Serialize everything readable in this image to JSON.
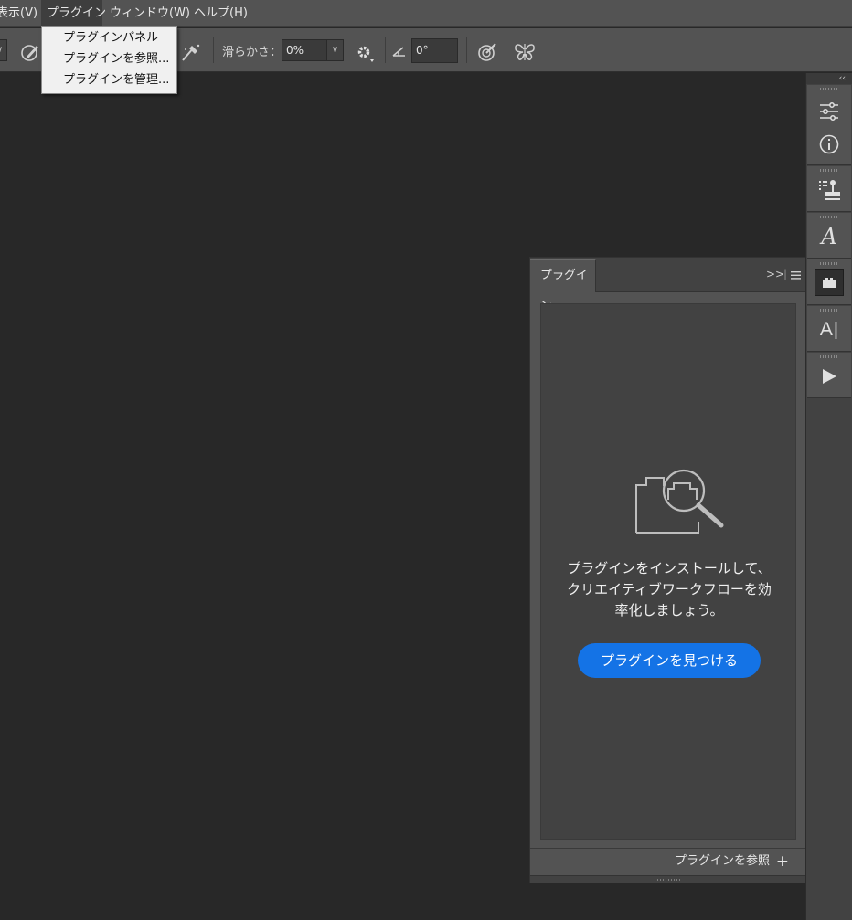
{
  "menubar": {
    "items": [
      {
        "label": "表示(V)"
      },
      {
        "label": "プラグイン"
      },
      {
        "label": "ウィンドウ(W)"
      },
      {
        "label": "ヘルプ(H)"
      }
    ]
  },
  "plugin_menu": {
    "items": [
      {
        "label": "プラグインパネル"
      },
      {
        "label": "プラグインを参照..."
      },
      {
        "label": "プラグインを管理..."
      }
    ]
  },
  "options": {
    "smoothing_label": "滑らかさ：",
    "smoothing_value": "0%",
    "angle_value": "0°"
  },
  "panel": {
    "tab_label": "プラグイン",
    "empty_message": "プラグインをインストールして、\nクリエイティブワークフローを効\n率化しましょう。",
    "find_button": "プラグインを見つける",
    "browse_link": "プラグインを参照",
    "add_symbol": "+"
  },
  "strip": {
    "collapse_symbol": "‹‹",
    "icons": [
      "adjustments-icon",
      "info-icon",
      "clone-source-icon",
      "glyphs-icon",
      "plugins-icon",
      "character-icon",
      "actions-play-icon"
    ]
  },
  "colors": {
    "accent": "#1473e6",
    "panel_bg": "#535353",
    "canvas_bg": "#282828"
  }
}
